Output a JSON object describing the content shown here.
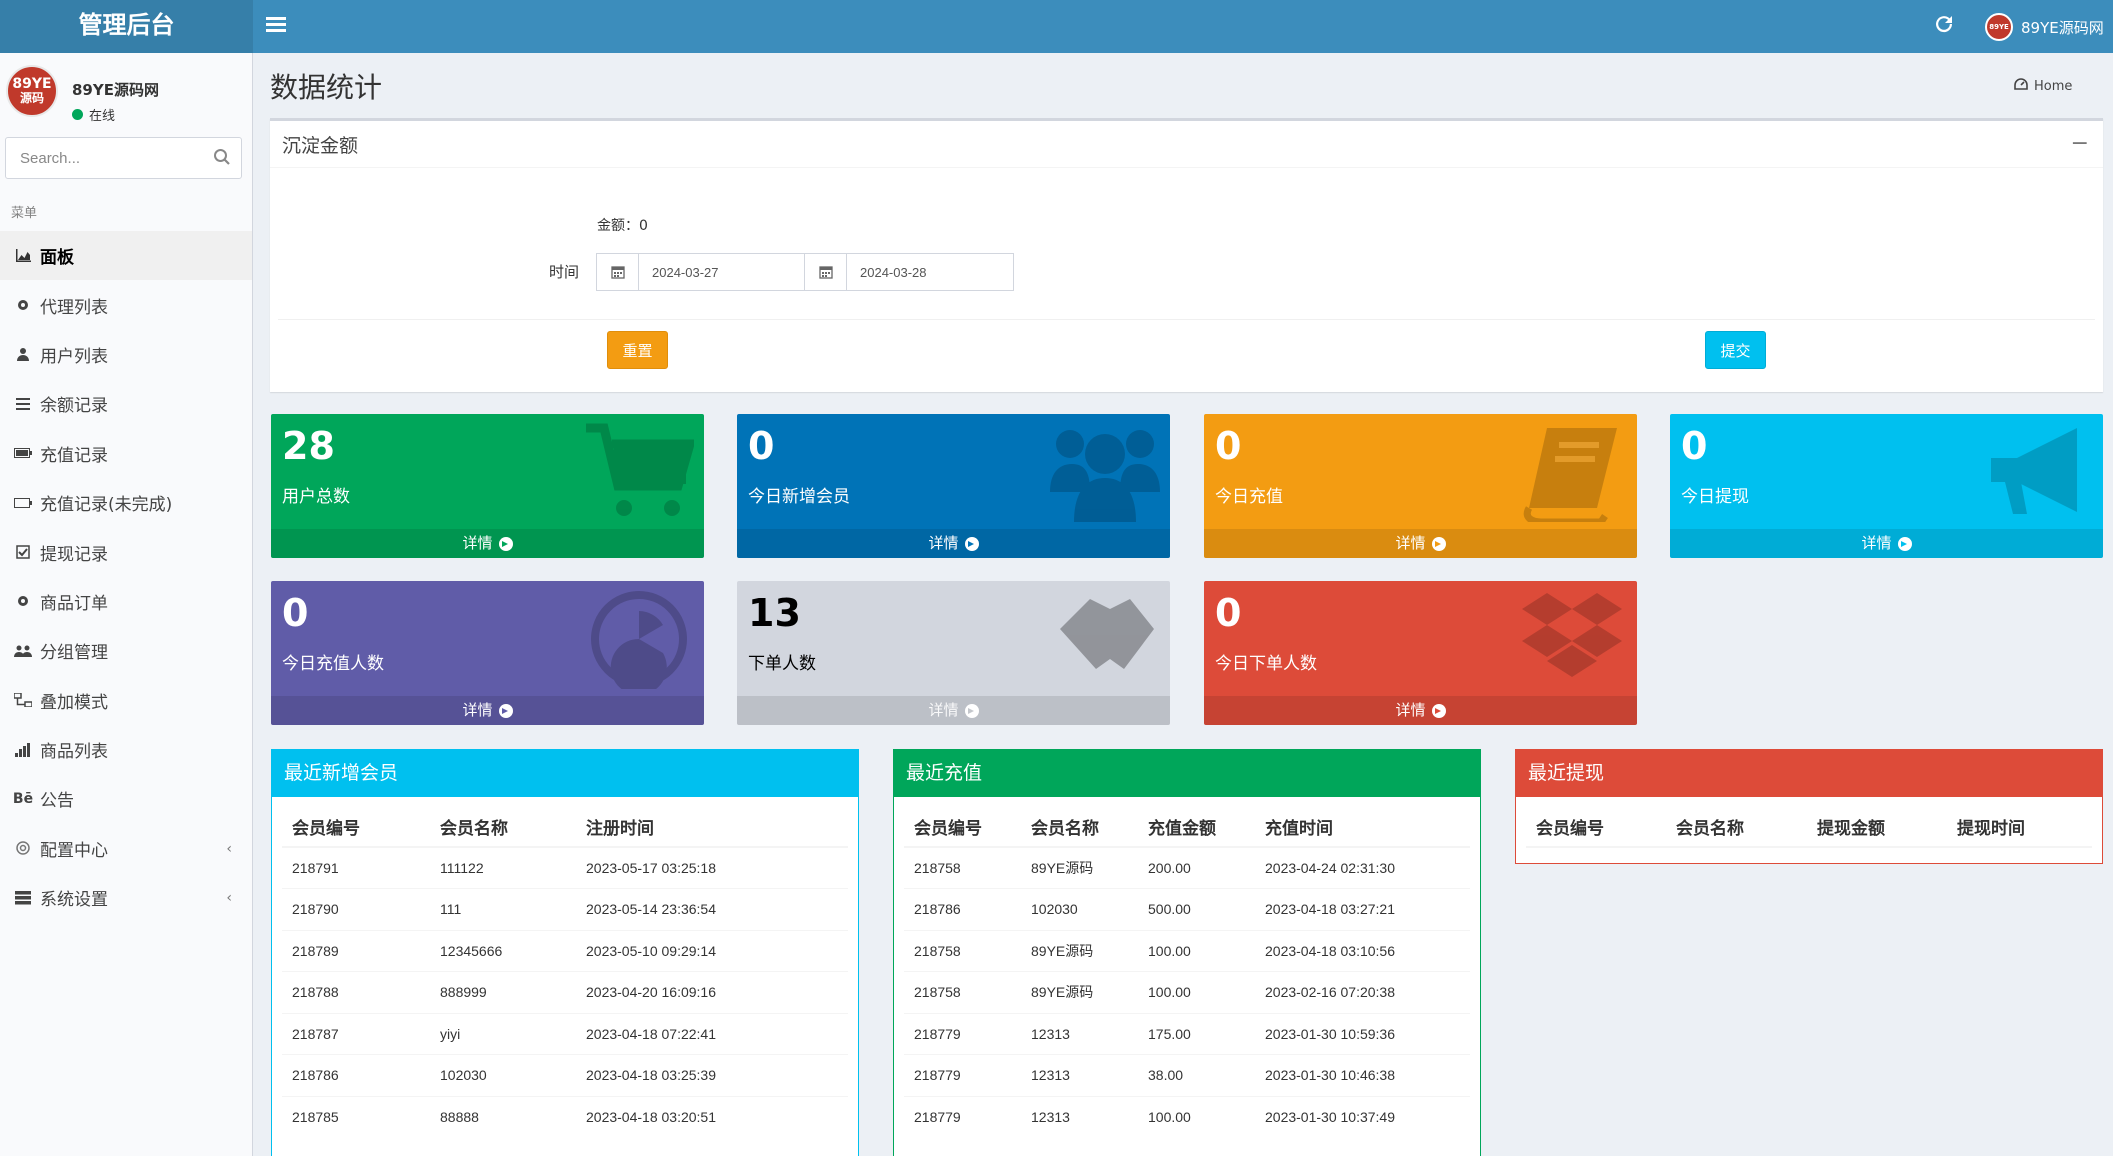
{
  "header": {
    "logo": "管理后台",
    "user_name": "89YE源码网",
    "avatar_text_top": "89YE",
    "avatar_text_bottom": "源码"
  },
  "sidebar": {
    "user_name": "89YE源码网",
    "status": "在线",
    "search_placeholder": "Search...",
    "menu_header": "菜单",
    "items": [
      {
        "label": "面板",
        "icon": "area-chart-icon",
        "active": true
      },
      {
        "label": "代理列表",
        "icon": "gear-icon"
      },
      {
        "label": "用户列表",
        "icon": "user-icon"
      },
      {
        "label": "余额记录",
        "icon": "list-icon"
      },
      {
        "label": "充值记录",
        "icon": "battery-icon"
      },
      {
        "label": "充值记录(未完成)",
        "icon": "battery-empty-icon"
      },
      {
        "label": "提现记录",
        "icon": "check-square-icon"
      },
      {
        "label": "商品订单",
        "icon": "gear-icon"
      },
      {
        "label": "分组管理",
        "icon": "users-icon"
      },
      {
        "label": "叠加模式",
        "icon": "sitemap-icon"
      },
      {
        "label": "商品列表",
        "icon": "signal-icon"
      },
      {
        "label": "公告",
        "icon": "behance-icon"
      },
      {
        "label": "配置中心",
        "icon": "gear-outline-icon",
        "has_children": true
      },
      {
        "label": "系统设置",
        "icon": "server-icon",
        "has_children": true
      }
    ]
  },
  "content": {
    "title": "数据统计",
    "breadcrumb": "Home"
  },
  "settle": {
    "title": "沉淀金额",
    "amount_label": "金额：0",
    "time_label": "时间",
    "start_date": "2024-03-27",
    "end_date": "2024-03-28",
    "reset_label": "重置",
    "submit_label": "提交"
  },
  "stats": [
    {
      "value": "28",
      "label": "用户总数",
      "footer": "详情",
      "color": "#00a65a",
      "icon": "shopping-cart-icon"
    },
    {
      "value": "0",
      "label": "今日新增会员",
      "footer": "详情",
      "color": "#0073b7",
      "icon": "users-icon"
    },
    {
      "value": "0",
      "label": "今日充值",
      "footer": "详情",
      "color": "#f39c12",
      "icon": "book-icon"
    },
    {
      "value": "0",
      "label": "今日提现",
      "footer": "详情",
      "color": "#00c0ef",
      "icon": "bullhorn-icon"
    },
    {
      "value": "0",
      "label": "今日充值人数",
      "footer": "详情",
      "color": "#605ca8",
      "icon": "pacman-icon"
    },
    {
      "value": "13",
      "label": "下单人数",
      "footer": "详情",
      "color": "#d2d6de",
      "icon": "handshake-icon"
    },
    {
      "value": "0",
      "label": "今日下单人数",
      "footer": "详情",
      "color": "#dd4b39",
      "icon": "dropbox-icon"
    }
  ],
  "recent_members": {
    "title": "最近新增会员",
    "columns": [
      "会员编号",
      "会员名称",
      "注册时间"
    ],
    "rows": [
      [
        "218791",
        "111122",
        "2023-05-17 03:25:18"
      ],
      [
        "218790",
        "111",
        "2023-05-14 23:36:54"
      ],
      [
        "218789",
        "12345666",
        "2023-05-10 09:29:14"
      ],
      [
        "218788",
        "888999",
        "2023-04-20 16:09:16"
      ],
      [
        "218787",
        "yiyi",
        "2023-04-18 07:22:41"
      ],
      [
        "218786",
        "102030",
        "2023-04-18 03:25:39"
      ],
      [
        "218785",
        "88888",
        "2023-04-18 03:20:51"
      ]
    ]
  },
  "recent_recharge": {
    "title": "最近充值",
    "columns": [
      "会员编号",
      "会员名称",
      "充值金额",
      "充值时间"
    ],
    "rows": [
      [
        "218758",
        "89YE源码",
        "200.00",
        "2023-04-24 02:31:30"
      ],
      [
        "218786",
        "102030",
        "500.00",
        "2023-04-18 03:27:21"
      ],
      [
        "218758",
        "89YE源码",
        "100.00",
        "2023-04-18 03:10:56"
      ],
      [
        "218758",
        "89YE源码",
        "100.00",
        "2023-02-16 07:20:38"
      ],
      [
        "218779",
        "12313",
        "175.00",
        "2023-01-30 10:59:36"
      ],
      [
        "218779",
        "12313",
        "38.00",
        "2023-01-30 10:46:38"
      ],
      [
        "218779",
        "12313",
        "100.00",
        "2023-01-30 10:37:49"
      ]
    ]
  },
  "recent_withdraw": {
    "title": "最近提现",
    "columns": [
      "会员编号",
      "会员名称",
      "提现金额",
      "提现时间"
    ],
    "rows": []
  }
}
